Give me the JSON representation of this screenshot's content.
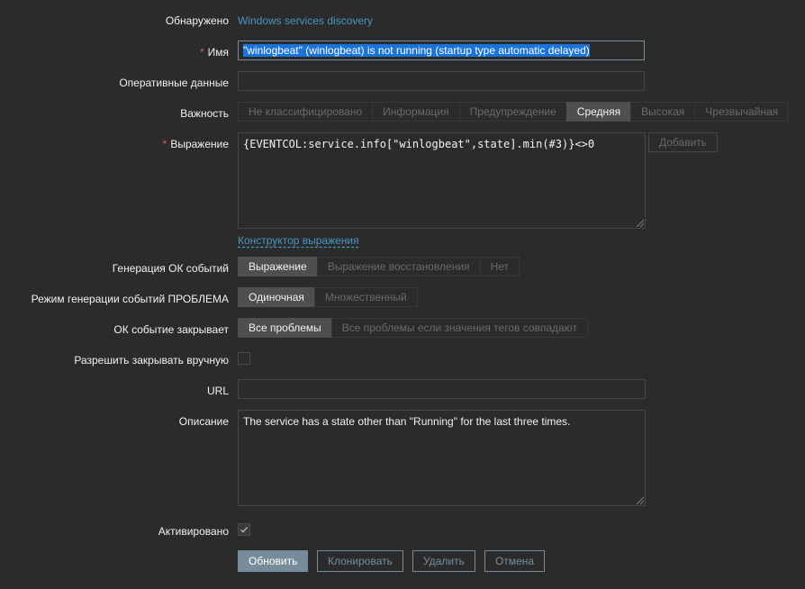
{
  "form": {
    "discovered": {
      "label": "Обнаружено",
      "value": "Windows services discovery"
    },
    "name": {
      "label": "Имя",
      "value": "\"winlogbeat\" (winlogbeat) is not running (startup type automatic delayed)"
    },
    "opdata": {
      "label": "Оперативные данные",
      "value": ""
    },
    "severity": {
      "label": "Важность",
      "options": [
        "Не классифицировано",
        "Информация",
        "Предупреждение",
        "Средняя",
        "Высокая",
        "Чрезвычайная"
      ],
      "selected": "Средняя"
    },
    "expression": {
      "label": "Выражение",
      "value": "{EVENTCOL:service.info[\"winlogbeat\",state].min(#3)}<>0",
      "add_label": "Добавить",
      "constructor_label": "Конструктор выражения"
    },
    "ok_event_generation": {
      "label": "Генерация ОК событий",
      "options": [
        "Выражение",
        "Выражение восстановления",
        "Нет"
      ],
      "selected": "Выражение"
    },
    "problem_event_mode": {
      "label": "Режим генерации событий ПРОБЛЕМА",
      "options": [
        "Одиночная",
        "Множественный"
      ],
      "selected": "Одиночная"
    },
    "ok_event_closes": {
      "label": "ОК событие закрывает",
      "options": [
        "Все проблемы",
        "Все проблемы если значения тегов совпадают"
      ],
      "selected": "Все проблемы"
    },
    "manual_close": {
      "label": "Разрешить закрывать вручную",
      "checked": false
    },
    "url": {
      "label": "URL",
      "value": ""
    },
    "description": {
      "label": "Описание",
      "value": "The service has a state other than \"Running\" for the last three times."
    },
    "enabled": {
      "label": "Активировано",
      "checked": true
    }
  },
  "buttons": {
    "update": "Обновить",
    "clone": "Клонировать",
    "delete": "Удалить",
    "cancel": "Отмена"
  },
  "colors": {
    "background": "#2b2b2b",
    "link": "#4796c4",
    "required": "#e45959",
    "button": "#768d99",
    "selection": "#1a73d7"
  }
}
